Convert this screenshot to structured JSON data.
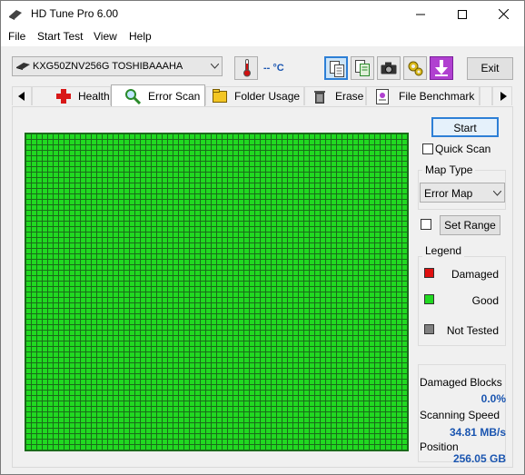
{
  "window": {
    "title": "HD Tune Pro 6.00"
  },
  "menu": [
    "File",
    "Start Test",
    "View",
    "Help"
  ],
  "toolbar": {
    "drive": "KXG50ZNV256G TOSHIBAAAHA",
    "temperature": "-- °C",
    "exit_label": "Exit"
  },
  "tabs": [
    {
      "label": "Health",
      "icon": "health-cross-icon"
    },
    {
      "label": "Error Scan",
      "icon": "magnifier-icon"
    },
    {
      "label": "Folder Usage",
      "icon": "folder-icon"
    },
    {
      "label": "Erase",
      "icon": "trash-icon"
    },
    {
      "label": "File Benchmark",
      "icon": "file-icon"
    }
  ],
  "active_tab": "Error Scan",
  "scan": {
    "start_label": "Start",
    "quick_scan_label": "Quick Scan",
    "quick_scan_checked": false,
    "map_type_title": "Map Type",
    "map_type_value": "Error Map",
    "set_range_label": "Set Range",
    "set_range_checked": false
  },
  "legend": {
    "title": "Legend",
    "items": [
      {
        "label": "Damaged",
        "color": "#e01010"
      },
      {
        "label": "Good",
        "color": "#21d921"
      },
      {
        "label": "Not Tested",
        "color": "#808080"
      }
    ]
  },
  "stats": {
    "damaged_blocks_label": "Damaged Blocks",
    "damaged_blocks_value": "0.0%",
    "scanning_speed_label": "Scanning Speed",
    "scanning_speed_value": "34.81 MB/s",
    "position_label": "Position",
    "position_value": "256.05 GB"
  },
  "colors": {
    "good_block": "#21d921",
    "accent": "#1a55b0"
  }
}
